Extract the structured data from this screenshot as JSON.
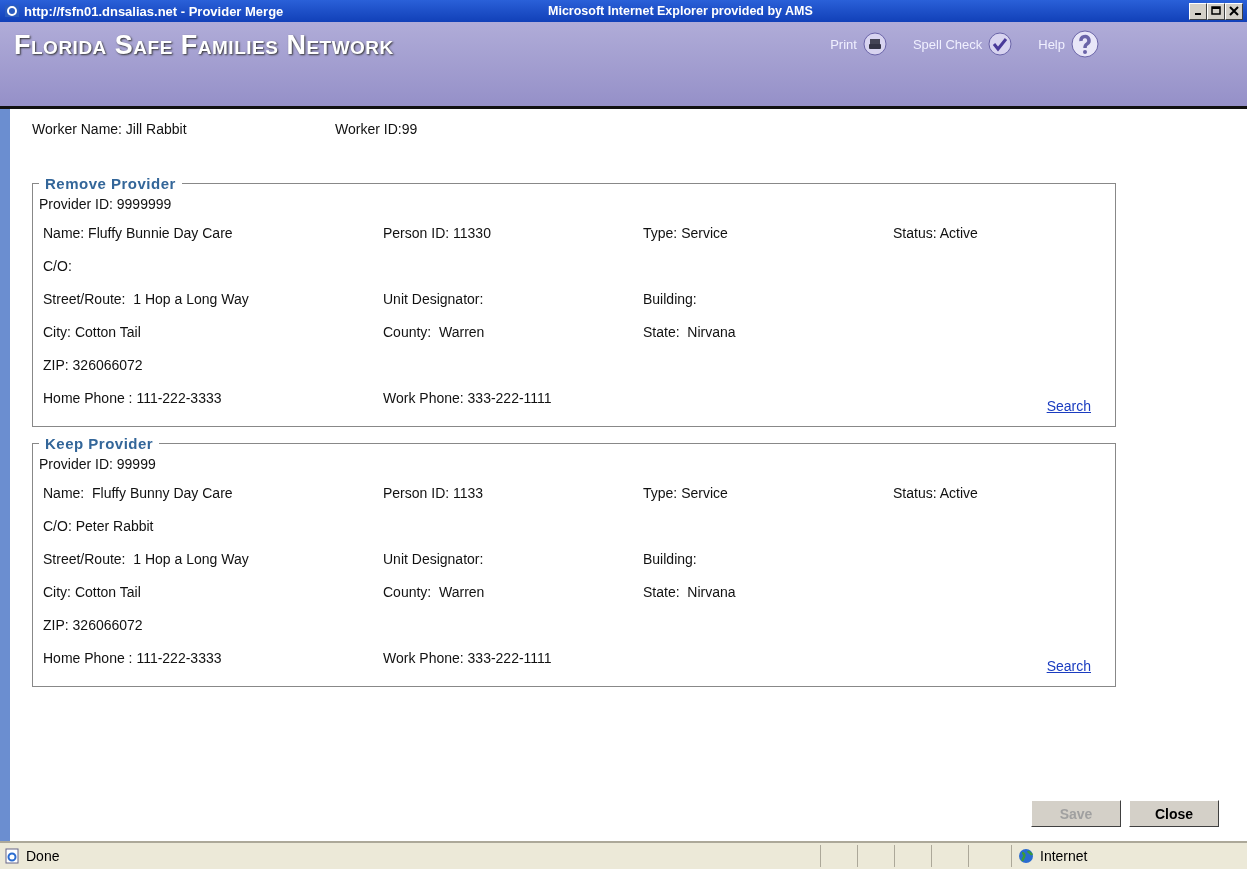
{
  "window": {
    "title": "http://fsfn01.dnsalias.net - Provider Merge",
    "browser_title": "Microsoft Internet Explorer provided by AMS"
  },
  "header": {
    "brand": "Florida Safe Families Network",
    "tools": [
      {
        "label": "Print",
        "kind": "print"
      },
      {
        "label": "Spell Check",
        "kind": "spell"
      },
      {
        "label": "Help",
        "kind": "help"
      }
    ]
  },
  "worker": {
    "name": "Worker Name: Jill Rabbit",
    "id": "Worker ID:99"
  },
  "sections": [
    {
      "title": "Remove Provider",
      "provider_id": "Provider ID: 9999999",
      "rows": [
        [
          "Name: Fluffy Bunnie Day Care",
          "Person ID: 11330",
          "Type: Service",
          "Status: Active"
        ],
        [
          "C/O:"
        ],
        [
          "Street/Route:  1 Hop a Long Way",
          "Unit Designator:",
          "Building:"
        ],
        [
          "City: Cotton Tail",
          "County:  Warren",
          "State:  Nirvana"
        ],
        [
          "ZIP: 326066072"
        ],
        [
          "Home Phone : 111-222-3333",
          "Work Phone: 333-222-1111"
        ]
      ],
      "link": "Search"
    },
    {
      "title": "Keep Provider",
      "provider_id": "Provider ID: 99999",
      "rows": [
        [
          "Name:  Fluffy Bunny Day Care",
          "Person ID: 1133",
          "Type: Service",
          "Status: Active"
        ],
        [
          "C/O: Peter Rabbit"
        ],
        [
          "Street/Route:  1 Hop a Long Way",
          "Unit Designator:",
          "Building:"
        ],
        [
          "City: Cotton Tail",
          "County:  Warren",
          "State:  Nirvana"
        ],
        [
          "ZIP: 326066072"
        ],
        [
          "Home Phone : 111-222-3333",
          "Work Phone: 333-222-1111"
        ]
      ],
      "link": "Search"
    }
  ],
  "buttons": [
    {
      "label": "Save",
      "disabled": true
    },
    {
      "label": "Close",
      "disabled": false
    }
  ],
  "status_bar": {
    "text": "Done",
    "zone": "Internet"
  }
}
